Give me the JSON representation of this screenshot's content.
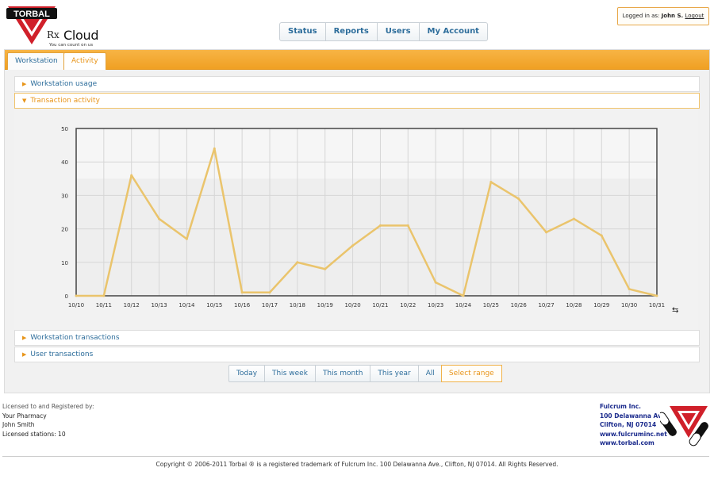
{
  "header": {
    "brand_top": "TORBAL",
    "rx": "Rx",
    "product": "Cloud",
    "tagline": "You can count on us",
    "login_prefix": "Logged in as:",
    "user": "John S.",
    "logout": "Logout"
  },
  "nav": [
    "Status",
    "Reports",
    "Users",
    "My Account"
  ],
  "tabs": {
    "workstation": "Workstation",
    "activity": "Activity"
  },
  "sections": {
    "workstation_usage": "Workstation usage",
    "transaction_activity": "Transaction activity",
    "workstation_transactions": "Workstation transactions",
    "user_transactions": "User transactions"
  },
  "ranges": [
    "Today",
    "This week",
    "This month",
    "This year",
    "All",
    "Select range"
  ],
  "chart_data": {
    "type": "line",
    "categories": [
      "10/10",
      "10/11",
      "10/12",
      "10/13",
      "10/14",
      "10/15",
      "10/16",
      "10/17",
      "10/18",
      "10/19",
      "10/20",
      "10/21",
      "10/22",
      "10/23",
      "10/24",
      "10/25",
      "10/26",
      "10/27",
      "10/28",
      "10/29",
      "10/30",
      "10/31"
    ],
    "values": [
      0,
      0,
      36,
      23,
      17,
      44,
      1,
      1,
      10,
      8,
      15,
      21,
      21,
      4,
      0,
      34,
      29,
      19,
      23,
      18,
      2,
      0
    ],
    "ylim": [
      0,
      50
    ],
    "yticks": [
      0,
      10,
      20,
      30,
      40,
      50
    ],
    "grid": true,
    "line_color": "#eac46c"
  },
  "footer": {
    "licensed_heading": "Licensed to and Registered by:",
    "pharmacy": "Your Pharmacy",
    "owner": "John Smith",
    "stations": "Licensed stations: 10",
    "company": "Fulcrum Inc.",
    "street": "100 Delawanna Ave.",
    "city": "Clifton, NJ 07014",
    "site1": "www.fulcruminc.net",
    "site2": "www.torbal.com",
    "copyright": "Copyright © 2006-2011 Torbal ® is a registered trademark of Fulcrum Inc. 100 Delawanna Ave., Clifton, NJ 07014. All Rights Reserved."
  }
}
